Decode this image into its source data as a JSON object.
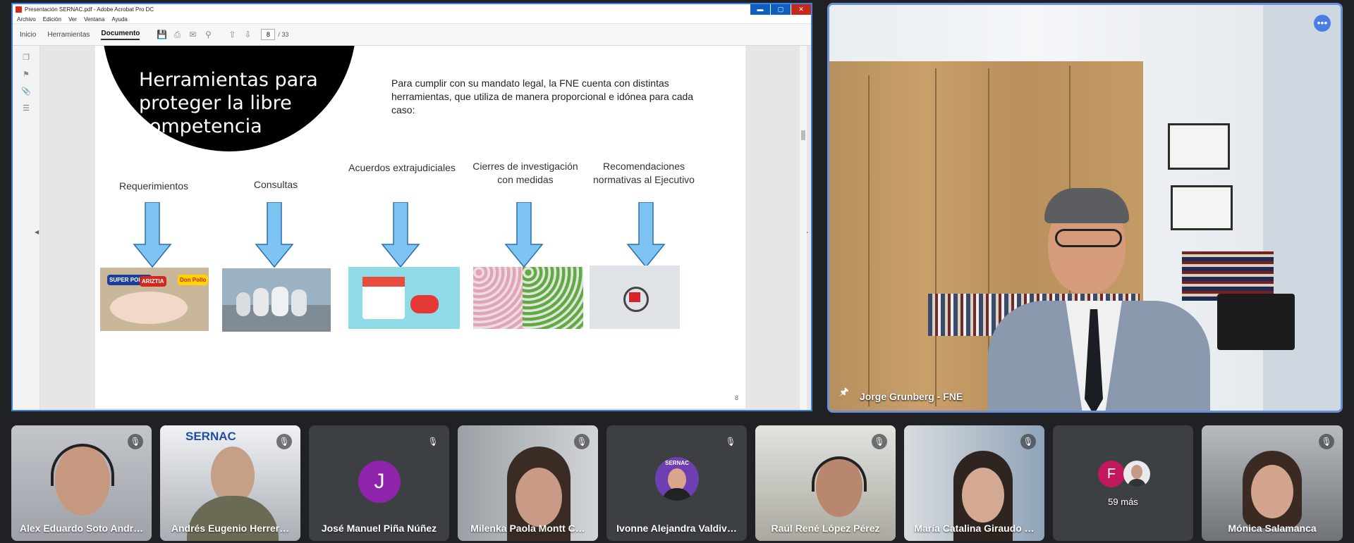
{
  "acrobat": {
    "title": "Presentación SERNAC.pdf - Adobe Acrobat Pro DC",
    "window_buttons": [
      "▬",
      "▢",
      "✕"
    ],
    "menu": [
      "Archivo",
      "Edición",
      "Ver",
      "Ventana",
      "Ayuda"
    ],
    "tabs": [
      "Inicio",
      "Herramientas",
      "Documento"
    ],
    "page_current": "8",
    "page_total": "/ 33",
    "slide": {
      "title": "Herramientas para proteger la libre competencia",
      "intro": "Para cumplir con su mandato legal, la FNE cuenta con distintas herramientas, que utiliza de manera proporcional e idónea para cada caso:",
      "page_number": "8",
      "tools": [
        {
          "label": "Requerimientos"
        },
        {
          "label": "Consultas"
        },
        {
          "label": "Acuerdos extrajudiciales"
        },
        {
          "label": "Cierres de investigación con medidas"
        },
        {
          "label": "Recomendaciones normativas al Ejecutivo"
        }
      ],
      "image_texts": [
        "SUPER POLLO",
        "ARIZTIA",
        "Don Pollo"
      ]
    }
  },
  "speaker": {
    "name": "Jorge Grunberg - FNE",
    "more_icon": "•••"
  },
  "participants": [
    {
      "name": "Alex Eduardo Soto Andr…"
    },
    {
      "name": "Andrés Eugenio Herrer…",
      "logo_text": "SERNAC"
    },
    {
      "name": "José Manuel Piña Núñez",
      "initial": "J"
    },
    {
      "name": "Milenka Paola Montt C…"
    },
    {
      "name": "Ivonne Alejandra Valdiv…",
      "logo_text": "SERNAC"
    },
    {
      "name": "Raúl René López Pérez"
    },
    {
      "name": "María Catalina Giraudo …"
    },
    {
      "name": "59 más",
      "initial": "F"
    },
    {
      "name": "Mónica Salamanca"
    }
  ],
  "colors": {
    "meet_bg": "#202124",
    "arrow_fill": "#7ec4f2",
    "avatar_j": "#8e24aa",
    "avatar_f": "#c2185b"
  }
}
